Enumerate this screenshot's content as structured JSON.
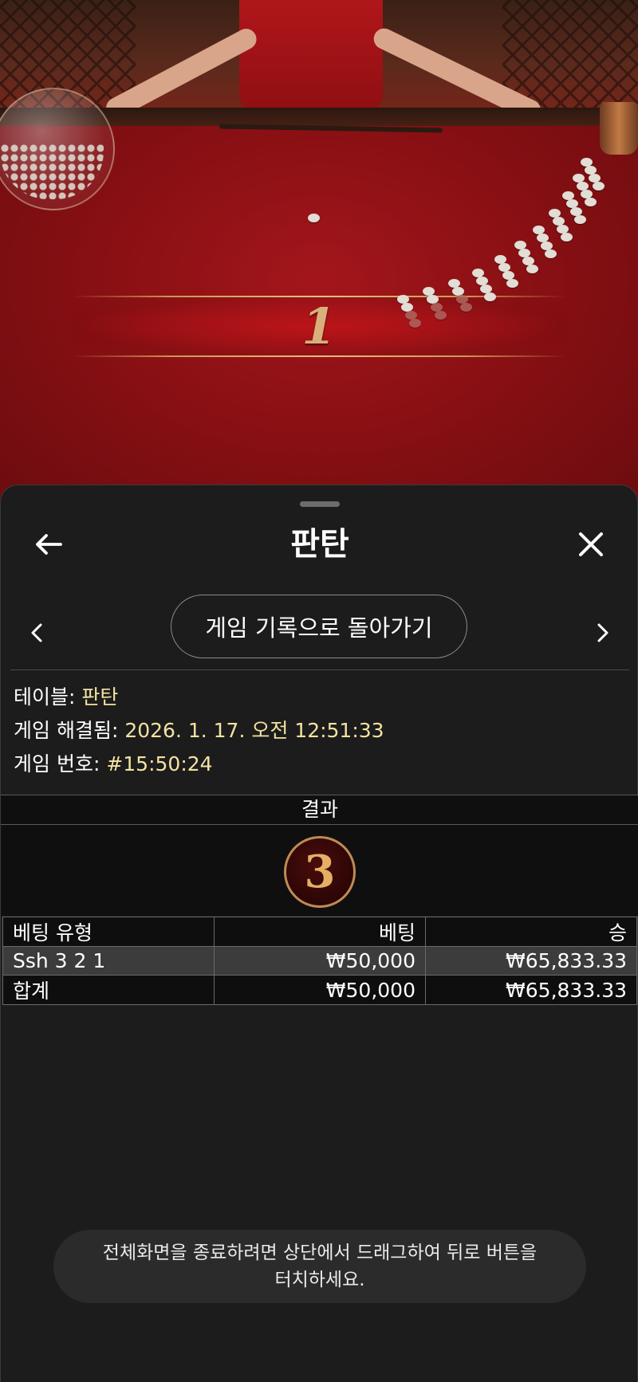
{
  "header": {
    "title": "판탄"
  },
  "nav": {
    "back_to_history": "게임 기록으로 돌아가기"
  },
  "video": {
    "result_number": "1"
  },
  "info": {
    "table_label": "테이블:",
    "table_value": "판탄",
    "resolved_label": "게임 해결됨:",
    "resolved_value": "2026. 1. 17. 오전 12:51:33",
    "game_no_label": "게임 번호:",
    "game_no_value": "#15:50:24"
  },
  "result": {
    "heading": "결과",
    "value": "3"
  },
  "bets_table": {
    "columns": [
      "베팅 유형",
      "베팅",
      "승"
    ],
    "rows": [
      {
        "type": "Ssh 3 2 1",
        "bet": "₩50,000",
        "win": "₩65,833.33"
      }
    ],
    "total": {
      "label": "합계",
      "bet": "₩50,000",
      "win": "₩65,833.33"
    }
  },
  "toast": {
    "line1": "전체화면을 종료하려면 상단에서 드래그하여 뒤로 버튼을",
    "line2": "터치하세요."
  },
  "colors": {
    "info_value": "#f3e3a2",
    "sheet_bg": "#1c1c1c",
    "felt": "#8a1014",
    "highlight_row": "#3c3c3c"
  },
  "icons": {
    "back": "arrow-left-icon",
    "close": "close-icon",
    "prev": "chevron-left-icon",
    "next": "chevron-right-icon"
  }
}
